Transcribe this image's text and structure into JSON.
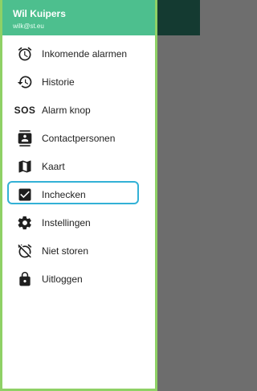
{
  "user": {
    "name": "Wil Kuipers",
    "email": "wilk@st.eu"
  },
  "menu": [
    {
      "label": "Inkomende alarmen",
      "icon": "alarm-clock-icon",
      "active": false
    },
    {
      "label": "Historie",
      "icon": "history-icon",
      "active": false
    },
    {
      "label": "Alarm knop",
      "icon": "sos-icon",
      "icon_text": "SOS",
      "active": false
    },
    {
      "label": "Contactpersonen",
      "icon": "contact-card-icon",
      "active": false
    },
    {
      "label": "Kaart",
      "icon": "map-icon",
      "active": false
    },
    {
      "label": "Inchecken",
      "icon": "checkbox-icon",
      "active": true
    },
    {
      "label": "Instellingen",
      "icon": "gear-icon",
      "active": false
    },
    {
      "label": "Niet storen",
      "icon": "alarm-off-icon",
      "active": false
    },
    {
      "label": "Uitloggen",
      "icon": "lock-icon",
      "active": false
    }
  ],
  "colors": {
    "header": "#4dbf8e",
    "drawer_border": "#8fd166",
    "active_outline": "#33b1d6",
    "topbar_dark": "#143a31",
    "scrim": "#6d6d6d"
  }
}
